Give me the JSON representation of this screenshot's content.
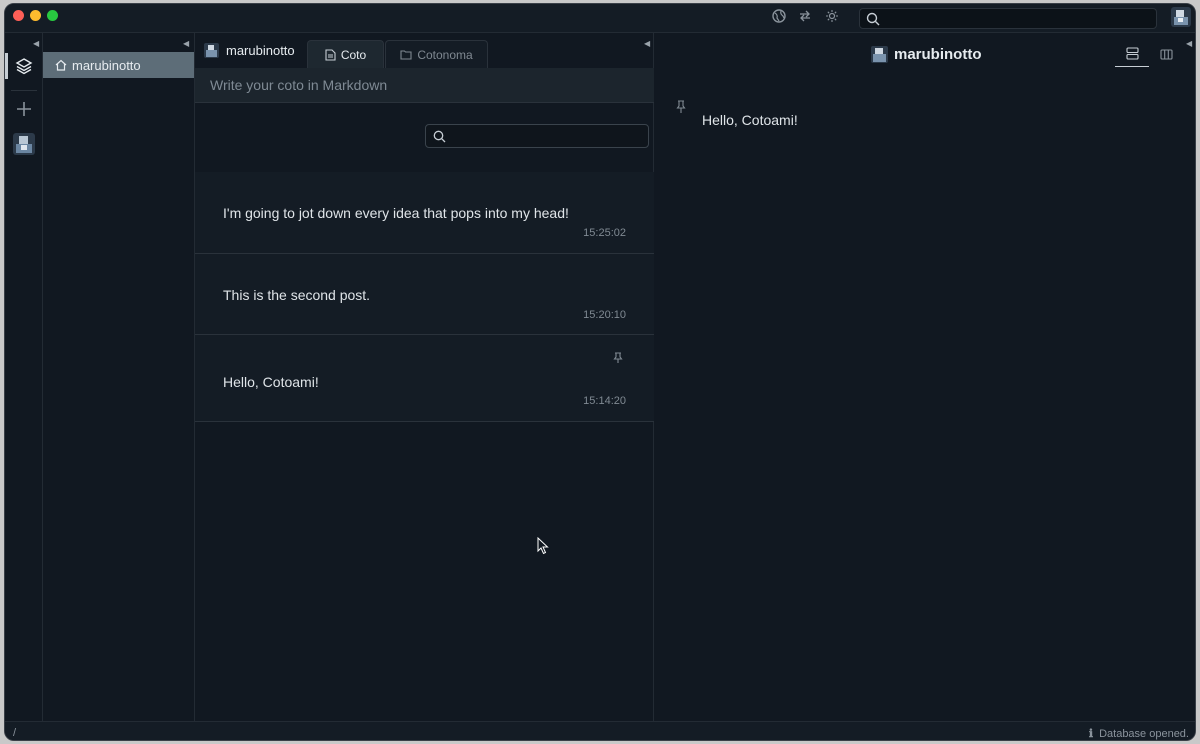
{
  "titlebar": {
    "icons": [
      "globe-icon",
      "swap-icon",
      "sun-icon"
    ],
    "search_placeholder": ""
  },
  "rail": {
    "icons": [
      "layers-icon",
      "plus-icon",
      "avatar"
    ]
  },
  "nav": {
    "items": [
      {
        "label": "marubinotto",
        "icon": "home-icon"
      }
    ]
  },
  "timeline": {
    "node_name": "marubinotto",
    "tabs": [
      {
        "label": "Coto",
        "icon": "document-icon",
        "active": true
      },
      {
        "label": "Cotonoma",
        "icon": "folder-icon",
        "active": false
      }
    ],
    "editor_placeholder": "Write your coto in Markdown",
    "search_placeholder": "",
    "cotos": [
      {
        "text": "I'm going to jot down every idea that pops into my head!",
        "time": "15:25:02",
        "pinned": false
      },
      {
        "text": "This is the second post.",
        "time": "15:20:10",
        "pinned": false
      },
      {
        "text": "Hello, Cotoami!",
        "time": "15:14:20",
        "pinned": true
      }
    ]
  },
  "pane": {
    "title": "marubinotto",
    "pinned_text": "Hello, Cotoami!",
    "view_icons": [
      "rows-icon",
      "columns-icon"
    ]
  },
  "statusbar": {
    "path": "/",
    "message": "Database opened."
  },
  "colors": {
    "background": "#111821",
    "panel": "#141c25",
    "nav_selected": "#5d6d78",
    "text": "#dfe4e8",
    "muted": "#808a93"
  }
}
